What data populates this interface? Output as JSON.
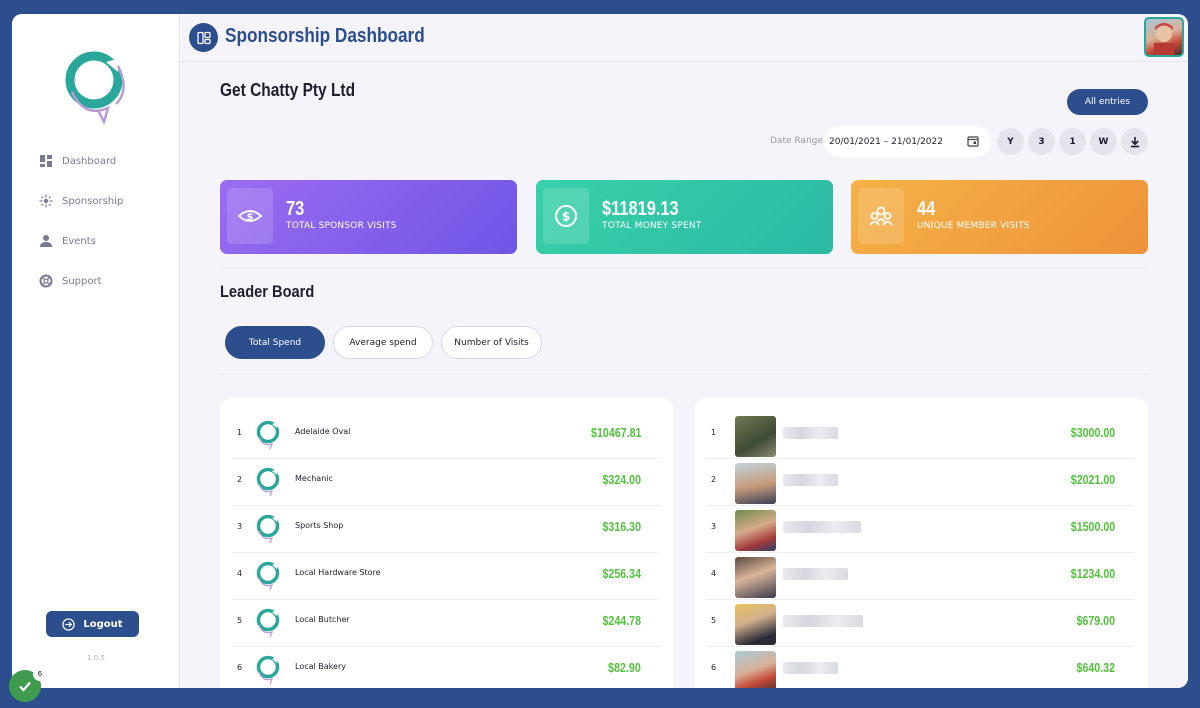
{
  "app": {
    "title": "Sponsorship Dashboard",
    "version": "1.0.5"
  },
  "colors": {
    "brand": "#2d4e8c",
    "positive": "#52c23c",
    "teal": "#2aa79b"
  },
  "sidebar": {
    "items": [
      {
        "label": "Dashboard",
        "icon": "dashboard-icon"
      },
      {
        "label": "Sponsorship",
        "icon": "sponsorship-icon"
      },
      {
        "label": "Events",
        "icon": "user-icon"
      },
      {
        "label": "Support",
        "icon": "lifebuoy-icon"
      }
    ],
    "logout_label": "Logout"
  },
  "header": {
    "company": "Get Chatty Pty Ltd",
    "all_entries_label": "All entries"
  },
  "date": {
    "label": "Date Range",
    "value": "20/01/2021 – 21/01/2022",
    "ranges": [
      "Y",
      "3",
      "1",
      "W"
    ]
  },
  "stats": [
    {
      "value": "73",
      "label": "TOTAL SPONSOR VISITS",
      "icon": "eye-dollar-icon",
      "gradient": [
        "#9b6cf0",
        "#6f55e6"
      ]
    },
    {
      "value": "$11819.13",
      "label": "TOTAL MONEY SPENT",
      "icon": "dollar-coin-icon",
      "gradient": [
        "#38d1a8",
        "#2bb9a5"
      ]
    },
    {
      "value": "44",
      "label": "UNIQUE MEMBER VISITS",
      "icon": "people-icon",
      "gradient": [
        "#f5b248",
        "#ee923a"
      ]
    }
  ],
  "leaderboard": {
    "title": "Leader Board",
    "tabs": [
      "Total Spend",
      "Average spend",
      "Number of Visits"
    ],
    "active_tab": "Total Spend",
    "sponsors": [
      {
        "rank": "1",
        "name": "Adelaide Oval",
        "amount": "$10467.81"
      },
      {
        "rank": "2",
        "name": "Mechanic",
        "amount": "$324.00"
      },
      {
        "rank": "3",
        "name": "Sports Shop",
        "amount": "$316.30"
      },
      {
        "rank": "4",
        "name": "Local Hardware Store",
        "amount": "$256.34"
      },
      {
        "rank": "5",
        "name": "Local Butcher",
        "amount": "$244.78"
      },
      {
        "rank": "6",
        "name": "Local Bakery",
        "amount": "$82.90"
      }
    ],
    "members": [
      {
        "rank": "1",
        "amount": "$3000.00"
      },
      {
        "rank": "2",
        "amount": "$2021.00"
      },
      {
        "rank": "3",
        "amount": "$1500.00"
      },
      {
        "rank": "4",
        "amount": "$1234.00"
      },
      {
        "rank": "5",
        "amount": "$679.00"
      },
      {
        "rank": "6",
        "amount": "$640.32"
      }
    ]
  },
  "notification": {
    "count": "6"
  }
}
